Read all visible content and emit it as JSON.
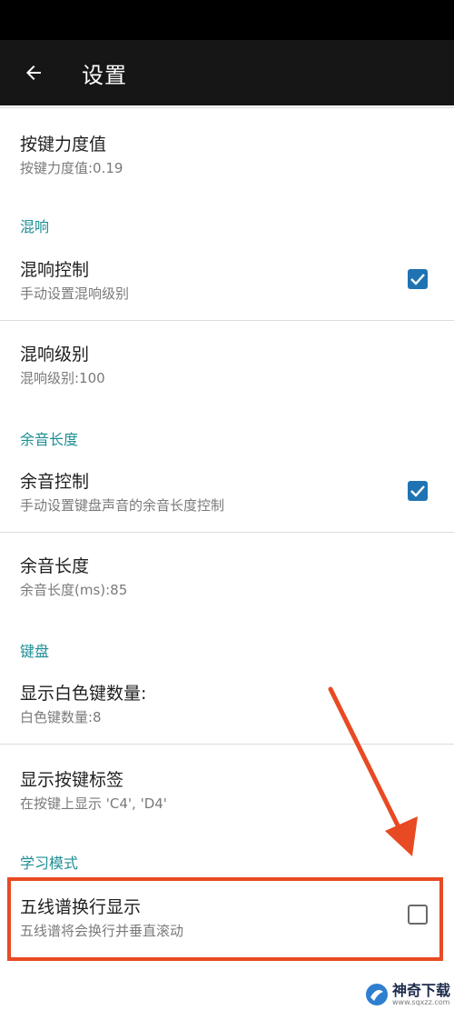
{
  "toolbar": {
    "title": "设置"
  },
  "prefs": {
    "velocity": {
      "title": "按键力度值",
      "summary": "按键力度值:0.19"
    },
    "reverb_category": "混响",
    "reverb_control": {
      "title": "混响控制",
      "summary": "手动设置混响级别",
      "checked": true
    },
    "reverb_level": {
      "title": "混响级别",
      "summary": "混响级别:100"
    },
    "sustain_category": "余音长度",
    "sustain_control": {
      "title": "余音控制",
      "summary": "手动设置键盘声音的余音长度控制",
      "checked": true
    },
    "sustain_length": {
      "title": "余音长度",
      "summary": "余音长度(ms):85"
    },
    "keyboard_category": "键盘",
    "white_keys": {
      "title": "显示白色键数量:",
      "summary": "白色键数量:8"
    },
    "key_labels": {
      "title": "显示按键标签",
      "summary": "在按键上显示 'C4', 'D4'"
    },
    "learning_category": "学习模式",
    "staff_wrap": {
      "title": "五线谱换行显示",
      "summary": "五线谱将会换行并垂直滚动",
      "checked": false
    }
  },
  "colors": {
    "accent": "#1e8f95",
    "checkbox": "#1f73b2",
    "highlight": "#e84a23"
  },
  "watermark": {
    "name": "神奇下载",
    "url": "www.sqxzz.com"
  }
}
